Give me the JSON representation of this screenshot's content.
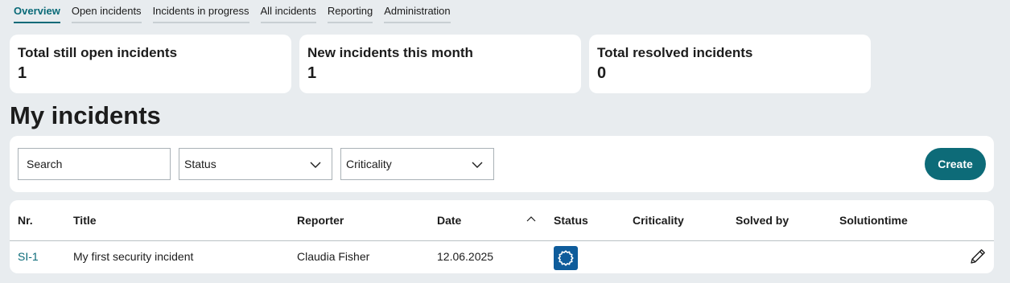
{
  "tabs": [
    {
      "label": "Overview",
      "active": true
    },
    {
      "label": "Open incidents",
      "active": false
    },
    {
      "label": "Incidents in progress",
      "active": false
    },
    {
      "label": "All incidents",
      "active": false
    },
    {
      "label": "Reporting",
      "active": false
    },
    {
      "label": "Administration",
      "active": false
    }
  ],
  "stats": [
    {
      "label": "Total still open incidents",
      "value": "1"
    },
    {
      "label": "New incidents this month",
      "value": "1"
    },
    {
      "label": "Total resolved incidents",
      "value": "0"
    }
  ],
  "page_title": "My incidents",
  "filters": {
    "search_placeholder": "Search",
    "status_label": "Status",
    "criticality_label": "Criticality",
    "create_label": "Create"
  },
  "table": {
    "headers": {
      "nr": "Nr.",
      "title": "Title",
      "reporter": "Reporter",
      "date": "Date",
      "status": "Status",
      "criticality": "Criticality",
      "solved_by": "Solved by",
      "solutiontime": "Solutiontime"
    },
    "sort_icon": "chevron-up-icon",
    "rows": [
      {
        "nr": "SI-1",
        "title": "My first security incident",
        "reporter": "Claudia Fisher",
        "date": "12.06.2025",
        "status_icon": "gear-status-icon",
        "criticality": "",
        "solved_by": "",
        "solutiontime": "",
        "action_icon": "pencil-edit-icon"
      }
    ]
  },
  "colors": {
    "accent": "#0a6a78",
    "create_button": "#0d6b78",
    "status_badge": "#0e5c9b",
    "page_background": "#e8ecef"
  }
}
